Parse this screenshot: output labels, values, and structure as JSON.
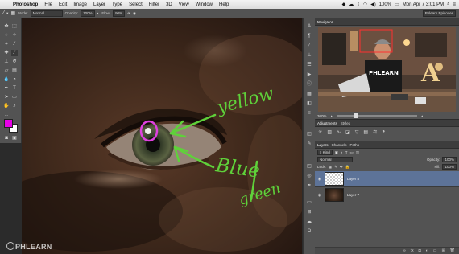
{
  "menubar": {
    "app_name": "Photoshop",
    "items": [
      "File",
      "Edit",
      "Image",
      "Layer",
      "Type",
      "Select",
      "Filter",
      "3D",
      "View",
      "Window",
      "Help"
    ],
    "clock": "Mon Apr 7  3:01 PM",
    "battery": "100%"
  },
  "options_bar": {
    "mode_label": "Mode:",
    "mode_value": "Normal",
    "opacity_label": "Opacity:",
    "opacity_value": "100%",
    "flow_label": "Flow:",
    "flow_value": "90%"
  },
  "workspace_button": "Phlearn Episodes",
  "navigator": {
    "tabs": [
      "Navigator"
    ],
    "zoom": "300%",
    "thumbnail_caption": "PHLEARN",
    "thumbnail_letter": "A"
  },
  "adjustments": {
    "tabs": [
      "Adjustments",
      "Styles"
    ]
  },
  "layers_panel": {
    "tabs": [
      "Layers",
      "Channels",
      "Paths"
    ],
    "filter_kind": "Kind",
    "blend_mode": "Normal",
    "opacity_label": "Opacity:",
    "opacity_value": "100%",
    "lock_label": "Lock:",
    "fill_label": "Fill:",
    "fill_value": "100%",
    "layers": [
      {
        "name": "Layer 8",
        "selected": true
      },
      {
        "name": "Layer 7",
        "selected": false
      }
    ]
  },
  "annotations": [
    "yellow",
    "Blue",
    "green"
  ],
  "watermark": "PHLEARN",
  "colors": {
    "foreground_swatch": "#e600e6",
    "background_swatch": "#ffffff",
    "annotation_green": "#5fd13a",
    "annotation_magenta": "#e040e0",
    "layer_selected": "#5d7398"
  }
}
